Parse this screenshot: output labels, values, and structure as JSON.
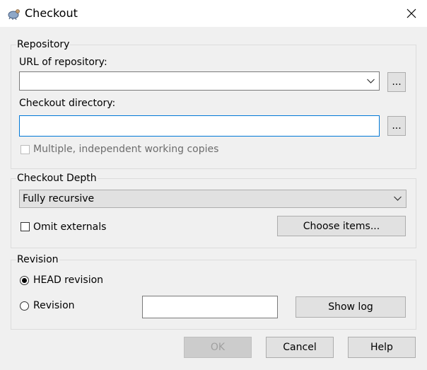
{
  "window": {
    "title": "Checkout",
    "icon": "tortoise-icon"
  },
  "repository": {
    "legend": "Repository",
    "url_label": "URL of repository:",
    "url_value": "",
    "browse_url_label": "...",
    "dir_label": "Checkout directory:",
    "dir_value": "",
    "browse_dir_label": "...",
    "multiple_label": "Multiple, independent working copies",
    "multiple_checked": false
  },
  "depth": {
    "legend": "Checkout Depth",
    "selected": "Fully recursive",
    "omit_label": "Omit externals",
    "omit_checked": false,
    "choose_items_label": "Choose items..."
  },
  "revision": {
    "legend": "Revision",
    "head_label": "HEAD revision",
    "head_selected": true,
    "revision_label": "Revision",
    "revision_value": "",
    "show_log_label": "Show log"
  },
  "footer": {
    "ok_label": "OK",
    "cancel_label": "Cancel",
    "help_label": "Help"
  }
}
